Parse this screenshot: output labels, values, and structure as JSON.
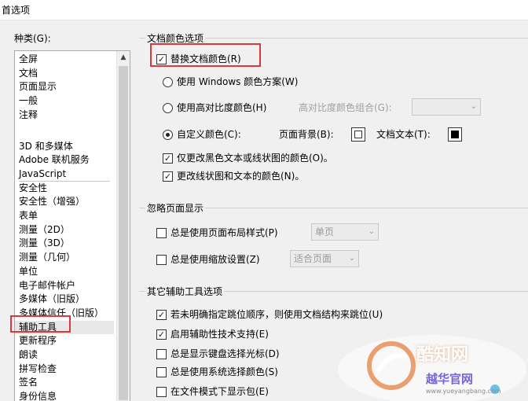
{
  "window": {
    "title": "首选项"
  },
  "categories": {
    "label": "种类(G):",
    "items": [
      {
        "label": "全屏"
      },
      {
        "label": "文档"
      },
      {
        "label": "页面显示"
      },
      {
        "label": "一般"
      },
      {
        "label": "注释"
      },
      {
        "label": "3D 和多媒体"
      },
      {
        "label": "Adobe 联机服务"
      },
      {
        "label": "JavaScript"
      },
      {
        "label": "安全性"
      },
      {
        "label": "安全性（增强）"
      },
      {
        "label": "表单"
      },
      {
        "label": "测量（2D）"
      },
      {
        "label": "测量（3D）"
      },
      {
        "label": "测量（几何）"
      },
      {
        "label": "单位"
      },
      {
        "label": "电子邮件帐户"
      },
      {
        "label": "多媒体（旧版）"
      },
      {
        "label": "多媒体信任（旧版）"
      },
      {
        "label": "辅助工具",
        "selected": true
      },
      {
        "label": "更新程序"
      },
      {
        "label": "朗读"
      },
      {
        "label": "拼写检查"
      },
      {
        "label": "签名"
      },
      {
        "label": "身份信息"
      }
    ]
  },
  "doc_colors": {
    "title": "文档颜色选项",
    "replace_colors": {
      "label": "替换文档颜色(R)",
      "checked": true
    },
    "windows_scheme": {
      "label": "使用 Windows 颜色方案(W)",
      "selected": false
    },
    "high_contrast": {
      "label": "使用高对比度颜色(H)",
      "selected": false
    },
    "high_contrast_combo_label": "高对比度颜色组合(G):",
    "high_contrast_combo_value": "",
    "custom_color": {
      "label": "自定义颜色(C):",
      "selected": true
    },
    "page_bg_label": "页面背景(B):",
    "page_bg_color": "#ffffff",
    "doc_text_label": "文档文本(T):",
    "doc_text_color": "#000000",
    "only_black": {
      "label": "仅更改黑色文本或线状图的颜色(O)。",
      "checked": true
    },
    "change_line": {
      "label": "更改线状图和文本的颜色(N)。",
      "checked": true
    }
  },
  "override_page": {
    "title": "忽略页面显示",
    "always_layout": {
      "label": "总是使用页面布局样式(P)",
      "checked": false
    },
    "layout_value": "单页",
    "always_zoom": {
      "label": "总是使用缩放设置(Z)",
      "checked": false
    },
    "zoom_value": "适合页面"
  },
  "other_tools": {
    "title": "其它辅助工具选项",
    "items": [
      {
        "label": "若未明确指定跳位顺序，则使用文档结构来跳位(U)",
        "checked": true
      },
      {
        "label": "启用辅助性技术支持(E)",
        "checked": true
      },
      {
        "label": "总是显示键盘选择光标(D)",
        "checked": false
      },
      {
        "label": "总是使用系统选择颜色(S)",
        "checked": false
      },
      {
        "label": "在文件模式下显示包(E)",
        "checked": false
      }
    ]
  },
  "watermark": {
    "brand": "酷知网",
    "site_name": "越华官网",
    "url": "www.yueyangbang.com"
  },
  "colors": {
    "highlight": "#d9383f",
    "selected_bg": "#e8e8e8"
  }
}
